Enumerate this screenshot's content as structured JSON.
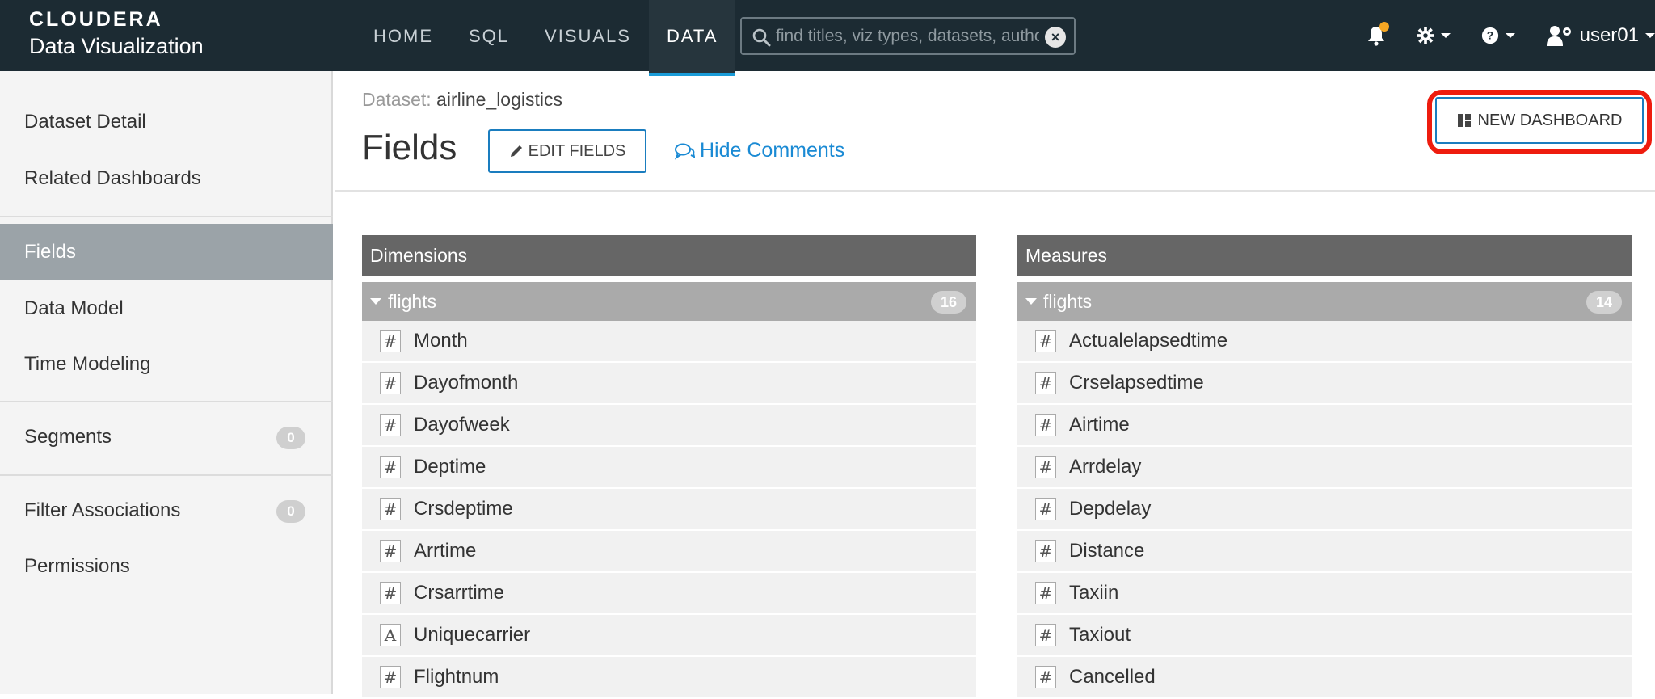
{
  "brand": {
    "top": "CLOUDERA",
    "bottom": "Data Visualization"
  },
  "nav": {
    "tabs": [
      {
        "label": "HOME"
      },
      {
        "label": "SQL"
      },
      {
        "label": "VISUALS"
      },
      {
        "label": "DATA",
        "active": true
      }
    ]
  },
  "search": {
    "placeholder": "find titles, viz types, datasets, authors"
  },
  "user": {
    "name": "user01"
  },
  "colors": {
    "accent": "#1a9cd8",
    "topbar": "#1c2b33",
    "highlight": "#ee1c0e",
    "notification": "#f5a623"
  },
  "sidebar": {
    "items": [
      {
        "label": "Dataset Detail"
      },
      {
        "label": "Related Dashboards"
      },
      {
        "label": "Fields",
        "active": true
      },
      {
        "label": "Data Model"
      },
      {
        "label": "Time Modeling"
      },
      {
        "label": "Segments",
        "badge": "0"
      },
      {
        "label": "Filter Associations",
        "badge": "0"
      },
      {
        "label": "Permissions"
      }
    ]
  },
  "header": {
    "dataset_prefix": "Dataset:",
    "dataset_name": "airline_logistics",
    "title": "Fields",
    "edit_fields": "EDIT FIELDS",
    "hide_comments": "Hide Comments",
    "new_dashboard": "NEW DASHBOARD"
  },
  "dimensions": {
    "title": "Dimensions",
    "group": {
      "name": "flights",
      "count": "16"
    },
    "fields": [
      {
        "name": "Month",
        "type": "#"
      },
      {
        "name": "Dayofmonth",
        "type": "#"
      },
      {
        "name": "Dayofweek",
        "type": "#"
      },
      {
        "name": "Deptime",
        "type": "#"
      },
      {
        "name": "Crsdeptime",
        "type": "#"
      },
      {
        "name": "Arrtime",
        "type": "#"
      },
      {
        "name": "Crsarrtime",
        "type": "#"
      },
      {
        "name": "Uniquecarrier",
        "type": "A"
      },
      {
        "name": "Flightnum",
        "type": "#"
      }
    ]
  },
  "measures": {
    "title": "Measures",
    "group": {
      "name": "flights",
      "count": "14"
    },
    "fields": [
      {
        "name": "Actualelapsedtime",
        "type": "#"
      },
      {
        "name": "Crselapsedtime",
        "type": "#"
      },
      {
        "name": "Airtime",
        "type": "#"
      },
      {
        "name": "Arrdelay",
        "type": "#"
      },
      {
        "name": "Depdelay",
        "type": "#"
      },
      {
        "name": "Distance",
        "type": "#"
      },
      {
        "name": "Taxiin",
        "type": "#"
      },
      {
        "name": "Taxiout",
        "type": "#"
      },
      {
        "name": "Cancelled",
        "type": "#"
      }
    ]
  }
}
